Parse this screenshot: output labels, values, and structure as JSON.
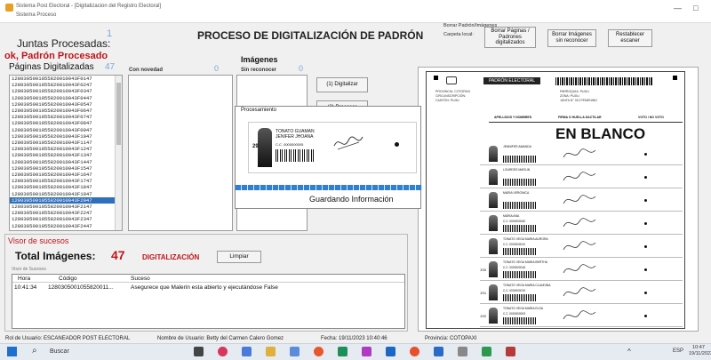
{
  "window": {
    "title": "Sistema Post Electoral - [Digitalizacion del Registro Electoral]",
    "menu": "Sistema   Proceso",
    "min": "—",
    "max": "□"
  },
  "header": {
    "main_title": "PROCESO DE DIGITALIZACIÓN DE PADRÓN",
    "juntas_label": "Juntas Procesadas:",
    "juntas_count": "1",
    "status_ok": "ok, Padrón Procesado",
    "paginas_label": "Páginas Digitalizadas",
    "paginas_count": "47",
    "con_novedad_label": "Con novedad",
    "con_novedad_count": "0",
    "imagenes_label": "Imágenes",
    "sin_reconocer_label": "Sin reconocer",
    "sin_reconocer_count": "0"
  },
  "top_right": {
    "group_label": "Borrar Padrón/Imágenes",
    "carpeta_label": "Carpeta local:",
    "btn_borrar_paginas": "Borrar Páginas / Padrones digitalizados",
    "btn_borrar_imagenes": "Borrar Imágenes sin reconocer",
    "btn_restablecer": "Restablecer escaner"
  },
  "pages_list": [
    "1280305001055820010043F0147",
    "1280305001055820010043F0247",
    "1280305001055820010043F0347",
    "1280305001055820010043F0447",
    "1280305001055820010043F0547",
    "1280305001055820010043F0647",
    "1280305001055820010043F0747",
    "1280305001055820010043F0847",
    "1280305001055820010043F0947",
    "1280305001055820010043F1047",
    "1280305001055820010043F1147",
    "1280305001055820010043F1247",
    "1280305001055820010043F1347",
    "1280305001055820010043F1447",
    "1280305001055820010043F1547",
    "1280305001055820010043F1647",
    "1280305001055820010043F1747",
    "1280305001055820010043F1847",
    "1280305001055820010043F1947",
    "1280305001055820010043F2047",
    "1280305001055820010043F2147",
    "1280305001055820010043F2247",
    "1280305001055820010043F2347",
    "1280305001055820010043F2447",
    "1280305001055820010043F2547"
  ],
  "selected_index": 19,
  "buttons": {
    "digitalizar": "(1) Digitalizar",
    "procesar": "(2) Procesar"
  },
  "processing": {
    "title": "Procesamiento",
    "person_name": "TONATO GUAMAN JENIFER JHOANA",
    "row_number": "29",
    "cedula": "C.C. 0000000005",
    "message": "Guardando Información",
    "progress": 1.0
  },
  "document": {
    "header": "PADRÓN ELECTORAL",
    "en_blanco": "EN BLANCO",
    "col_names": "APELLIDOS Y NOMBRES",
    "col_firma": "FIRMA O HUELLA DACTILAR",
    "col_voto": "VOTO / NO VOTO",
    "provincia": "PROVINCIA: COTOPAXI",
    "circunscripcion": "CIRCUNSCRIPCIÓN:",
    "canton": "CANTÓN: PUJILI",
    "parroquia": "PARROQUIA: PUJILI",
    "zona": "ZONA: PUJILI",
    "junta": "JUNTA N° 010 FEMENINO",
    "rows": [
      {
        "n": "",
        "name": "JENNIFER AMANDA",
        "cc": ""
      },
      {
        "n": "",
        "name": "LOURDES MARLIN",
        "cc": ""
      },
      {
        "n": "",
        "name": "MARIA VERONICA",
        "cc": ""
      },
      {
        "n": "",
        "name": "MARIA ANA",
        "cc": "C.C. 0000000040"
      },
      {
        "n": "",
        "name": "TONATO VEGA MARIA AURORA",
        "cc": "C.C. 0000000012"
      },
      {
        "n": "1S0",
        "name": "TONATO VEGA MARIA BERTHA",
        "cc": "C.C. 0000000018"
      },
      {
        "n": "1S1",
        "name": "TONATO VEGA MARIA CLAUDINA",
        "cc": "C.C. 0000000019"
      },
      {
        "n": "1S2",
        "name": "TONATO VEGA MARIA ELSA",
        "cc": "C.C. 0000000003"
      }
    ]
  },
  "visor": {
    "title": "Visor de sucesos",
    "total_label": "Total Imágenes:",
    "total_value": "47",
    "mode": "DIGITALIZACIÓN",
    "limpiar": "Limpiar",
    "sub_label": "Visor de Sucesos",
    "columns": [
      "Hora",
      "Código",
      "Suceso"
    ],
    "rows": [
      {
        "hora": "10:41:34",
        "codigo": "1280305001055820011...",
        "suceso": "Asegurece que Malerin esta abierto y ejecutándose False"
      }
    ]
  },
  "statusbar": {
    "rol": "Rol de Usuario: ESCANEADOR POST ELECTORAL",
    "nombre": "Nombre de Usuario: Betty del Carmen Calero Gomez",
    "fecha": "Fecha: 19/11/2023 10:40:46",
    "provincia": "Provincia: COTOPAXI"
  },
  "taskbar": {
    "search_placeholder": "Buscar",
    "lang": "ESP",
    "time": "10:47",
    "date": "19/11/2023"
  },
  "colors": {
    "accent_red": "#c0141a",
    "accent_blue": "#7aa9d8",
    "selection": "#2f6fbd",
    "progress": "#2f7fd6"
  }
}
